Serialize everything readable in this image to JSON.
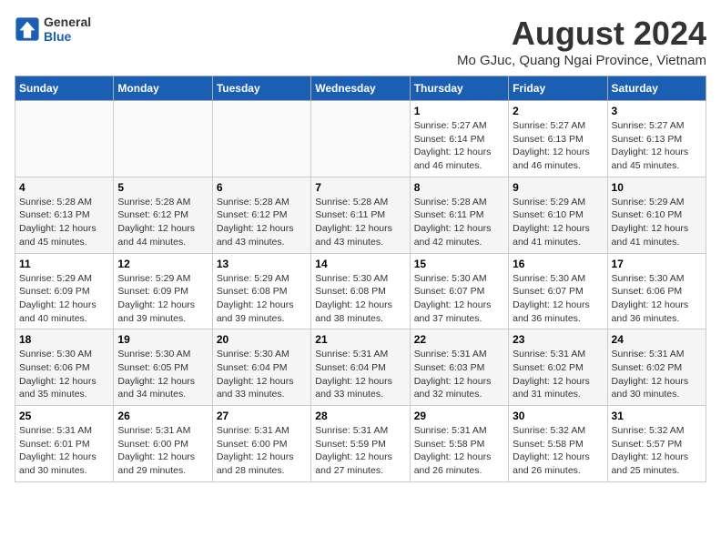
{
  "header": {
    "logo_line1": "General",
    "logo_line2": "Blue",
    "title": "August 2024",
    "subtitle": "Mo GJuc, Quang Ngai Province, Vietnam"
  },
  "calendar": {
    "days_of_week": [
      "Sunday",
      "Monday",
      "Tuesday",
      "Wednesday",
      "Thursday",
      "Friday",
      "Saturday"
    ],
    "weeks": [
      [
        {
          "day": "",
          "info": ""
        },
        {
          "day": "",
          "info": ""
        },
        {
          "day": "",
          "info": ""
        },
        {
          "day": "",
          "info": ""
        },
        {
          "day": "1",
          "info": "Sunrise: 5:27 AM\nSunset: 6:14 PM\nDaylight: 12 hours\nand 46 minutes."
        },
        {
          "day": "2",
          "info": "Sunrise: 5:27 AM\nSunset: 6:13 PM\nDaylight: 12 hours\nand 46 minutes."
        },
        {
          "day": "3",
          "info": "Sunrise: 5:27 AM\nSunset: 6:13 PM\nDaylight: 12 hours\nand 45 minutes."
        }
      ],
      [
        {
          "day": "4",
          "info": "Sunrise: 5:28 AM\nSunset: 6:13 PM\nDaylight: 12 hours\nand 45 minutes."
        },
        {
          "day": "5",
          "info": "Sunrise: 5:28 AM\nSunset: 6:12 PM\nDaylight: 12 hours\nand 44 minutes."
        },
        {
          "day": "6",
          "info": "Sunrise: 5:28 AM\nSunset: 6:12 PM\nDaylight: 12 hours\nand 43 minutes."
        },
        {
          "day": "7",
          "info": "Sunrise: 5:28 AM\nSunset: 6:11 PM\nDaylight: 12 hours\nand 43 minutes."
        },
        {
          "day": "8",
          "info": "Sunrise: 5:28 AM\nSunset: 6:11 PM\nDaylight: 12 hours\nand 42 minutes."
        },
        {
          "day": "9",
          "info": "Sunrise: 5:29 AM\nSunset: 6:10 PM\nDaylight: 12 hours\nand 41 minutes."
        },
        {
          "day": "10",
          "info": "Sunrise: 5:29 AM\nSunset: 6:10 PM\nDaylight: 12 hours\nand 41 minutes."
        }
      ],
      [
        {
          "day": "11",
          "info": "Sunrise: 5:29 AM\nSunset: 6:09 PM\nDaylight: 12 hours\nand 40 minutes."
        },
        {
          "day": "12",
          "info": "Sunrise: 5:29 AM\nSunset: 6:09 PM\nDaylight: 12 hours\nand 39 minutes."
        },
        {
          "day": "13",
          "info": "Sunrise: 5:29 AM\nSunset: 6:08 PM\nDaylight: 12 hours\nand 39 minutes."
        },
        {
          "day": "14",
          "info": "Sunrise: 5:30 AM\nSunset: 6:08 PM\nDaylight: 12 hours\nand 38 minutes."
        },
        {
          "day": "15",
          "info": "Sunrise: 5:30 AM\nSunset: 6:07 PM\nDaylight: 12 hours\nand 37 minutes."
        },
        {
          "day": "16",
          "info": "Sunrise: 5:30 AM\nSunset: 6:07 PM\nDaylight: 12 hours\nand 36 minutes."
        },
        {
          "day": "17",
          "info": "Sunrise: 5:30 AM\nSunset: 6:06 PM\nDaylight: 12 hours\nand 36 minutes."
        }
      ],
      [
        {
          "day": "18",
          "info": "Sunrise: 5:30 AM\nSunset: 6:06 PM\nDaylight: 12 hours\nand 35 minutes."
        },
        {
          "day": "19",
          "info": "Sunrise: 5:30 AM\nSunset: 6:05 PM\nDaylight: 12 hours\nand 34 minutes."
        },
        {
          "day": "20",
          "info": "Sunrise: 5:30 AM\nSunset: 6:04 PM\nDaylight: 12 hours\nand 33 minutes."
        },
        {
          "day": "21",
          "info": "Sunrise: 5:31 AM\nSunset: 6:04 PM\nDaylight: 12 hours\nand 33 minutes."
        },
        {
          "day": "22",
          "info": "Sunrise: 5:31 AM\nSunset: 6:03 PM\nDaylight: 12 hours\nand 32 minutes."
        },
        {
          "day": "23",
          "info": "Sunrise: 5:31 AM\nSunset: 6:02 PM\nDaylight: 12 hours\nand 31 minutes."
        },
        {
          "day": "24",
          "info": "Sunrise: 5:31 AM\nSunset: 6:02 PM\nDaylight: 12 hours\nand 30 minutes."
        }
      ],
      [
        {
          "day": "25",
          "info": "Sunrise: 5:31 AM\nSunset: 6:01 PM\nDaylight: 12 hours\nand 30 minutes."
        },
        {
          "day": "26",
          "info": "Sunrise: 5:31 AM\nSunset: 6:00 PM\nDaylight: 12 hours\nand 29 minutes."
        },
        {
          "day": "27",
          "info": "Sunrise: 5:31 AM\nSunset: 6:00 PM\nDaylight: 12 hours\nand 28 minutes."
        },
        {
          "day": "28",
          "info": "Sunrise: 5:31 AM\nSunset: 5:59 PM\nDaylight: 12 hours\nand 27 minutes."
        },
        {
          "day": "29",
          "info": "Sunrise: 5:31 AM\nSunset: 5:58 PM\nDaylight: 12 hours\nand 26 minutes."
        },
        {
          "day": "30",
          "info": "Sunrise: 5:32 AM\nSunset: 5:58 PM\nDaylight: 12 hours\nand 26 minutes."
        },
        {
          "day": "31",
          "info": "Sunrise: 5:32 AM\nSunset: 5:57 PM\nDaylight: 12 hours\nand 25 minutes."
        }
      ]
    ]
  }
}
